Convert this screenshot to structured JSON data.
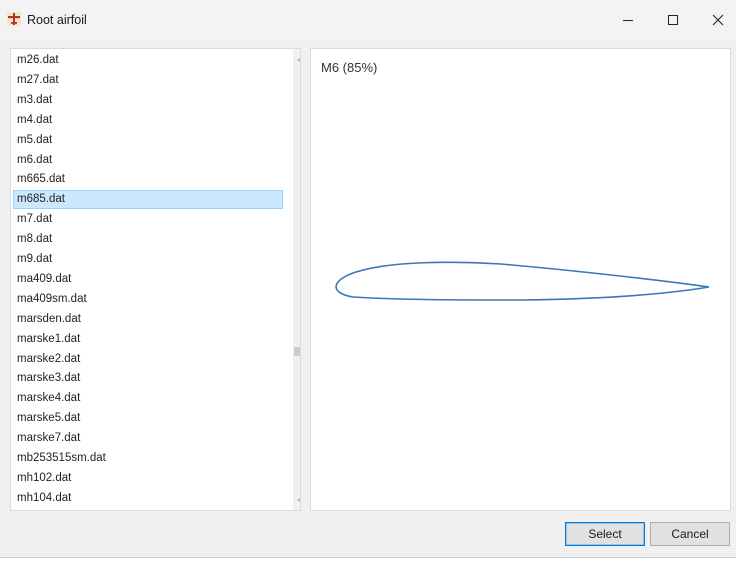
{
  "window": {
    "title": "Root airfoil",
    "controls": {
      "minimize": "minimize-icon",
      "maximize": "maximize-icon",
      "close": "close-icon"
    }
  },
  "file_list": {
    "items": [
      "m26.dat",
      "m27.dat",
      "m3.dat",
      "m4.dat",
      "m5.dat",
      "m6.dat",
      "m665.dat",
      "m685.dat",
      "m7.dat",
      "m8.dat",
      "m9.dat",
      "ma409.dat",
      "ma409sm.dat",
      "marsden.dat",
      "marske1.dat",
      "marske2.dat",
      "marske3.dat",
      "marske4.dat",
      "marske5.dat",
      "marske7.dat",
      "mb253515sm.dat",
      "mh102.dat",
      "mh104.dat"
    ],
    "selected": "m685.dat"
  },
  "preview": {
    "title": "M6 (85%)",
    "airfoil_color": "#3a77b8"
  },
  "buttons": {
    "select": "Select",
    "cancel": "Cancel"
  },
  "colors": {
    "selection_bg": "#cce8ff",
    "selection_border": "#99d1ff",
    "default_button_border": "#0078d7"
  }
}
